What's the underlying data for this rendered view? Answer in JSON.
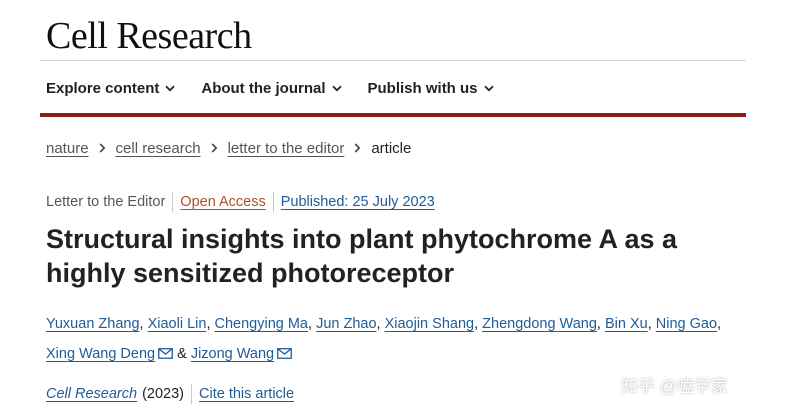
{
  "header": {
    "journal_title": "Cell Research"
  },
  "nav": {
    "items": [
      {
        "label": "Explore content",
        "icon": "chevron-down-icon"
      },
      {
        "label": "About the journal",
        "icon": "chevron-down-icon"
      },
      {
        "label": "Publish with us",
        "icon": "chevron-down-icon"
      }
    ]
  },
  "breadcrumb": {
    "links": [
      "nature",
      "cell research",
      "letter to the editor"
    ],
    "current": "article"
  },
  "article": {
    "type": "Letter to the Editor",
    "open_access": "Open Access",
    "published": "Published: 25 July 2023",
    "title": "Structural insights into plant phytochrome A as a highly sensitized photoreceptor",
    "authors": [
      "Yuxuan Zhang",
      "Xiaoli Lin",
      "Chengying Ma",
      "Jun Zhao",
      "Xiaojin Shang",
      "Zhengdong Wang",
      "Bin Xu",
      "Ning Gao",
      "Xing Wang Deng",
      "Jizong Wang"
    ],
    "author_separator": ",",
    "and": "&",
    "corresponding_icon": "envelope-icon"
  },
  "citation": {
    "journal": "Cell Research",
    "year": "(2023)",
    "cite": "Cite this article"
  },
  "watermark": "知乎 @嗑学家",
  "colors": {
    "accent_bar": "#8a1c1c",
    "link": "#1f5c99",
    "open_access": "#b0512a"
  }
}
